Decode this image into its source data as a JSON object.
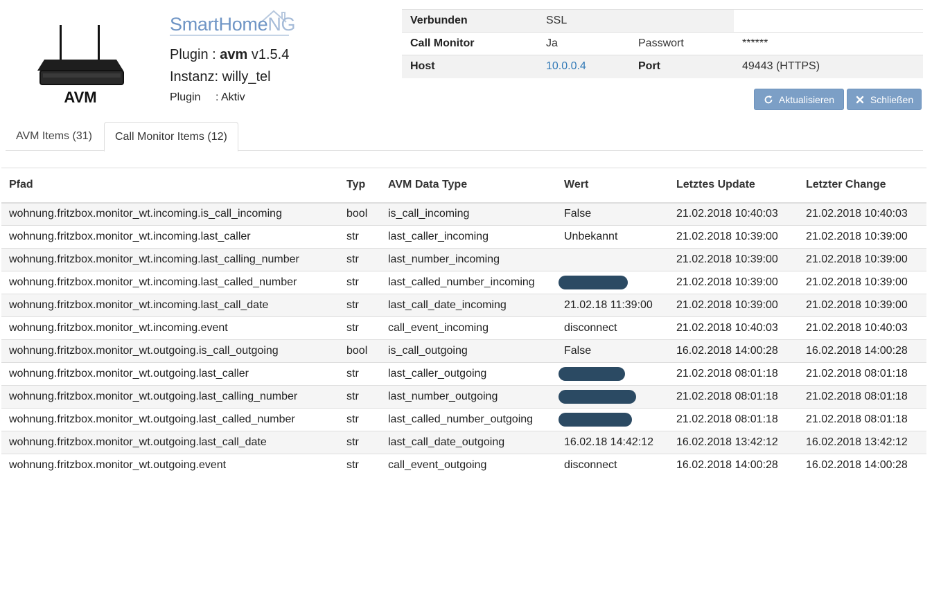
{
  "brand": {
    "name_main": "SmartHome",
    "name_ng": "NG"
  },
  "router_label": "AVM",
  "plugin": {
    "title_prefix": "Plugin : ",
    "name": "avm",
    "version": " v1.5.4",
    "instance": "Instanz: willy_tel",
    "status_key": "Plugin",
    "status_value": ": Aktiv"
  },
  "info": {
    "connected_label": "Verbunden",
    "connected_value": "SSL",
    "callmonitor_label": "Call Monitor",
    "callmonitor_value": "Ja",
    "password_label": "Passwort",
    "password_value": "******",
    "host_label": "Host",
    "host_value": "10.0.0.4",
    "port_label": "Port",
    "port_value": "49443 (HTTPS)"
  },
  "buttons": {
    "refresh": "Aktualisieren",
    "close": "Schließen"
  },
  "tabs": [
    {
      "label": "AVM Items (31)",
      "active": false
    },
    {
      "label": "Call Monitor Items (12)",
      "active": true
    }
  ],
  "table": {
    "headers": [
      "Pfad",
      "Typ",
      "AVM Data Type",
      "Wert",
      "Letztes Update",
      "Letzter Change"
    ],
    "rows": [
      {
        "path": "wohnung.fritzbox.monitor_wt.incoming.is_call_incoming",
        "typ": "bool",
        "dtype": "is_call_incoming",
        "wert": "False",
        "redacted": false,
        "update": "21.02.2018 10:40:03",
        "change": "21.02.2018 10:40:03"
      },
      {
        "path": "wohnung.fritzbox.monitor_wt.incoming.last_caller",
        "typ": "str",
        "dtype": "last_caller_incoming",
        "wert": "Unbekannt",
        "redacted": false,
        "update": "21.02.2018 10:39:00",
        "change": "21.02.2018 10:39:00"
      },
      {
        "path": "wohnung.fritzbox.monitor_wt.incoming.last_calling_number",
        "typ": "str",
        "dtype": "last_number_incoming",
        "wert": "",
        "redacted": false,
        "update": "21.02.2018 10:39:00",
        "change": "21.02.2018 10:39:00"
      },
      {
        "path": "wohnung.fritzbox.monitor_wt.incoming.last_called_number",
        "typ": "str",
        "dtype": "last_called_number_incoming",
        "wert": "",
        "redacted": true,
        "update": "21.02.2018 10:39:00",
        "change": "21.02.2018 10:39:00"
      },
      {
        "path": "wohnung.fritzbox.monitor_wt.incoming.last_call_date",
        "typ": "str",
        "dtype": "last_call_date_incoming",
        "wert": "21.02.18 11:39:00",
        "redacted": false,
        "update": "21.02.2018 10:39:00",
        "change": "21.02.2018 10:39:00"
      },
      {
        "path": "wohnung.fritzbox.monitor_wt.incoming.event",
        "typ": "str",
        "dtype": "call_event_incoming",
        "wert": "disconnect",
        "redacted": false,
        "update": "21.02.2018 10:40:03",
        "change": "21.02.2018 10:40:03"
      },
      {
        "path": "wohnung.fritzbox.monitor_wt.outgoing.is_call_outgoing",
        "typ": "bool",
        "dtype": "is_call_outgoing",
        "wert": "False",
        "redacted": false,
        "update": "16.02.2018 14:00:28",
        "change": "16.02.2018 14:00:28"
      },
      {
        "path": "wohnung.fritzbox.monitor_wt.outgoing.last_caller",
        "typ": "str",
        "dtype": "last_caller_outgoing",
        "wert": "",
        "redacted": true,
        "update": "21.02.2018 08:01:18",
        "change": "21.02.2018 08:01:18"
      },
      {
        "path": "wohnung.fritzbox.monitor_wt.outgoing.last_calling_number",
        "typ": "str",
        "dtype": "last_number_outgoing",
        "wert": "",
        "redacted": true,
        "update": "21.02.2018 08:01:18",
        "change": "21.02.2018 08:01:18"
      },
      {
        "path": "wohnung.fritzbox.monitor_wt.outgoing.last_called_number",
        "typ": "str",
        "dtype": "last_called_number_outgoing",
        "wert": "",
        "redacted": true,
        "update": "21.02.2018 08:01:18",
        "change": "21.02.2018 08:01:18"
      },
      {
        "path": "wohnung.fritzbox.monitor_wt.outgoing.last_call_date",
        "typ": "str",
        "dtype": "last_call_date_outgoing",
        "wert": "16.02.18 14:42:12",
        "redacted": false,
        "update": "16.02.2018 13:42:12",
        "change": "16.02.2018 13:42:12"
      },
      {
        "path": "wohnung.fritzbox.monitor_wt.outgoing.event",
        "typ": "str",
        "dtype": "call_event_outgoing",
        "wert": "disconnect",
        "redacted": false,
        "update": "16.02.2018 14:00:28",
        "change": "16.02.2018 14:00:28"
      }
    ]
  },
  "icons": {
    "refresh": "refresh-icon",
    "close": "close-x-icon",
    "router": "router-icon",
    "house": "house-roof-icon"
  },
  "colors": {
    "accent": "#7c9fc6",
    "link": "#337ab7",
    "brand": "#6f95c5",
    "redaction": "#2b4a63"
  }
}
